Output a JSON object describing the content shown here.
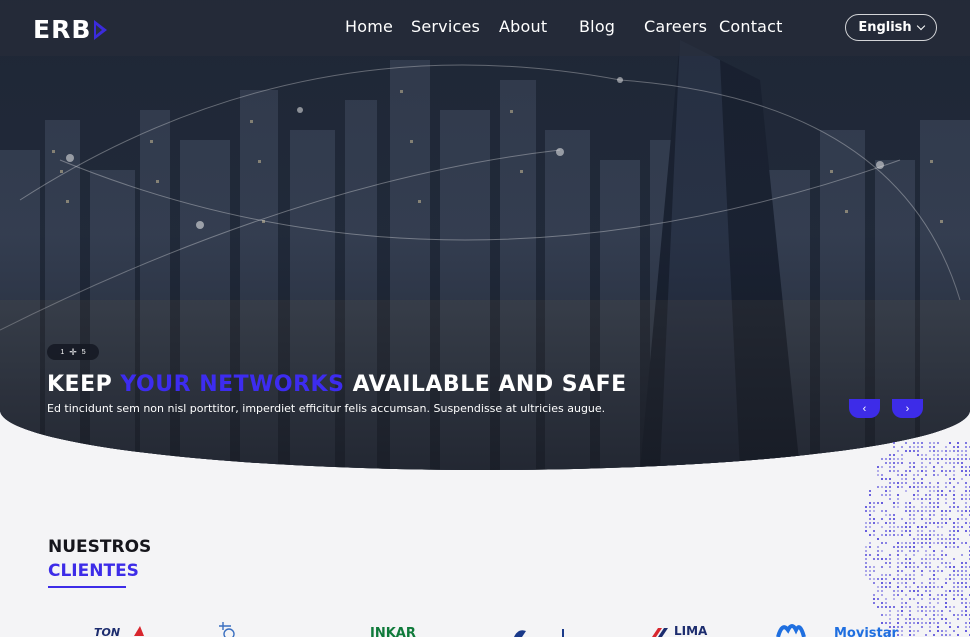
{
  "brand": {
    "name": "ERB",
    "accent": "#3d2ce8"
  },
  "nav": {
    "items": [
      "Home",
      "Services",
      "About",
      "Blog",
      "Careers",
      "Contact"
    ]
  },
  "language": {
    "selected": "English"
  },
  "hero": {
    "counter": {
      "current": "1",
      "separator_icon": "plus-icon",
      "total": "5"
    },
    "headline_pre": "KEEP ",
    "headline_accent": "YOUR NETWORKS",
    "headline_post": " AVAILABLE AND SAFE",
    "subline": "Ed tincidunt sem non nisl porttitor, imperdiet efficitur felis accumsan.  Suspendisse at ultricies augue.",
    "prev_icon": "chevron-left-icon",
    "next_icon": "chevron-right-icon"
  },
  "clients": {
    "title_line1": "NUESTROS",
    "title_line2": "CLIENTES",
    "logos": [
      {
        "name": "client-logo-1",
        "text": "TON"
      },
      {
        "name": "client-logo-2",
        "text": ""
      },
      {
        "name": "client-logo-3",
        "text": "INKAR"
      },
      {
        "name": "client-logo-4",
        "text": ""
      },
      {
        "name": "client-logo-5",
        "text": "LIMA"
      },
      {
        "name": "client-logo-6",
        "text": "Movistar"
      }
    ]
  }
}
